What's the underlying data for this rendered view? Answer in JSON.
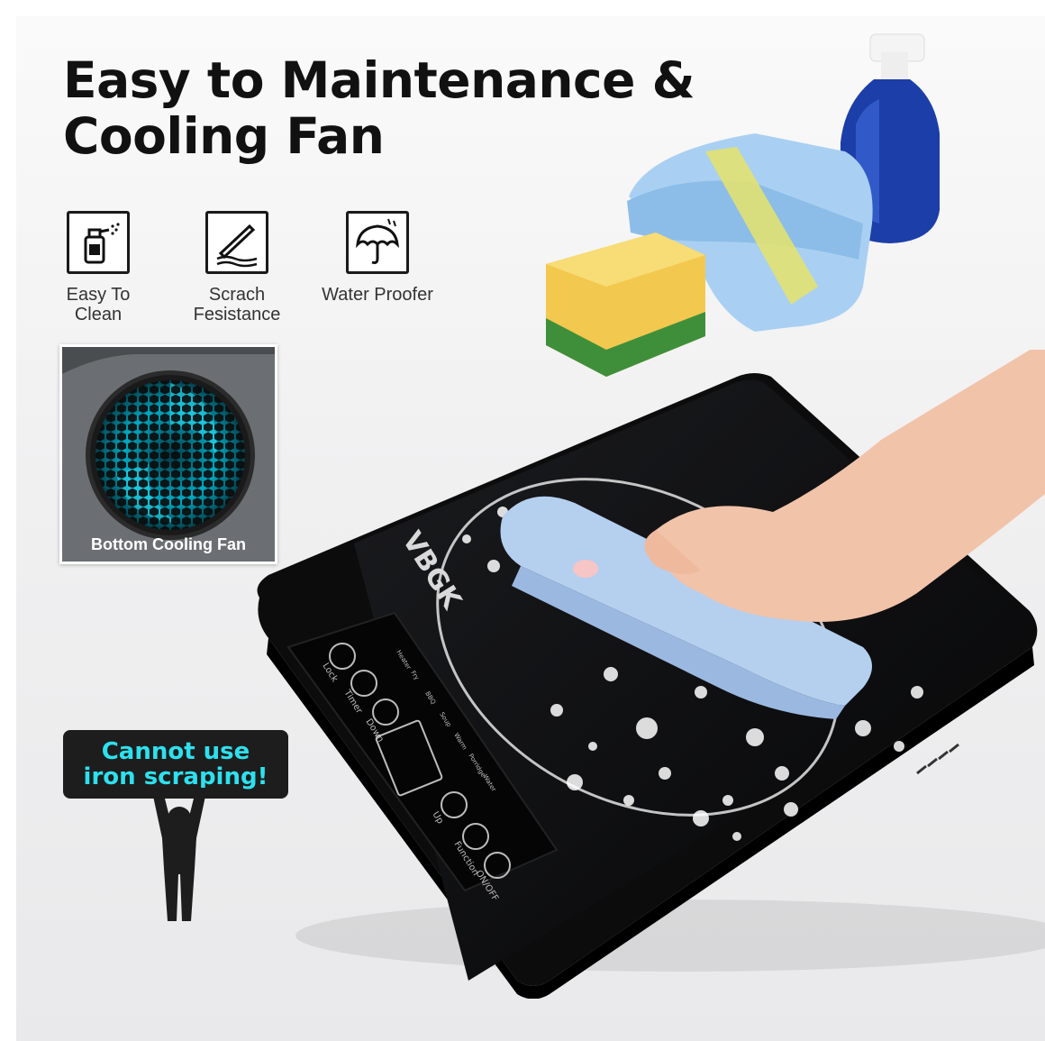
{
  "headline": {
    "line1": "Easy to Maintenance &",
    "line2": "Cooling Fan"
  },
  "features": [
    {
      "label": "Easy To\nClean",
      "icon": "spray-bottle-icon"
    },
    {
      "label": "Scrach\nFesistance",
      "icon": "scratch-resistance-icon"
    },
    {
      "label": "Water Proofer",
      "icon": "umbrella-icon"
    }
  ],
  "fan_callout": {
    "label": "Bottom Cooling Fan"
  },
  "warning": {
    "line1": "Cannot use",
    "line2": "iron scraping!",
    "color": "#2ee0ee"
  },
  "stove": {
    "brand": "VBGK",
    "panel_labels": [
      "Lock",
      "Timer",
      "Down",
      "Up",
      "Function",
      "ON/OFF"
    ],
    "mode_labels": [
      "Heater",
      "Fry",
      "BBQ",
      "Soup",
      "Warm",
      "Porridge",
      "Water"
    ]
  },
  "colors": {
    "cyan_text": "#2ee0ee",
    "stove_black": "#111111",
    "sponge_yellow": "#f6d35a",
    "sponge_green": "#3f8f3a",
    "towel_blue": "#9ec9ee"
  }
}
